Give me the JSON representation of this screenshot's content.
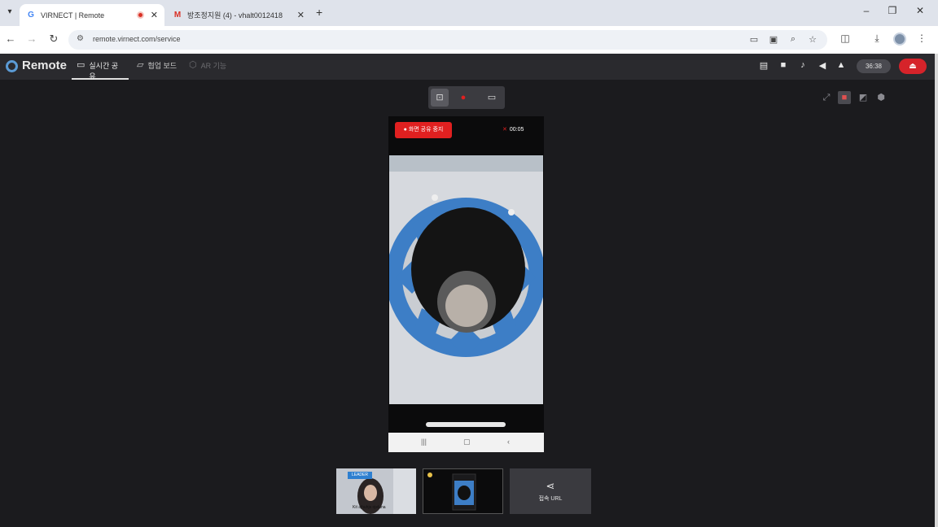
{
  "browser": {
    "tabs": [
      {
        "title": "VIRNECT | Remote",
        "favicon": "google-icon",
        "active": true
      },
      {
        "title": "방조정지원 (4) - vhalt0012418",
        "favicon": "gmail-icon",
        "active": false
      }
    ],
    "url": "remote.virnect.com/service",
    "window_controls": {
      "minimize": "–",
      "restore": "❐",
      "close": "✕"
    }
  },
  "app": {
    "logo_text": "Remote",
    "tabs": [
      {
        "label": "실시간 공유",
        "icon": "screen-share-icon"
      },
      {
        "label": "협업 보드",
        "icon": "board-icon"
      },
      {
        "label": "AR 기능",
        "icon": "ar-icon"
      }
    ],
    "timer": "36:38",
    "accent": "#d6232a"
  },
  "stream": {
    "record_label": "● 화면 공유 중지",
    "elapsed": "00:05"
  },
  "thumbnails": {
    "participant_tag": "LEADER",
    "participant_name": "Kit ajhuhjs ojeluna",
    "share_label": "접속 URL"
  }
}
